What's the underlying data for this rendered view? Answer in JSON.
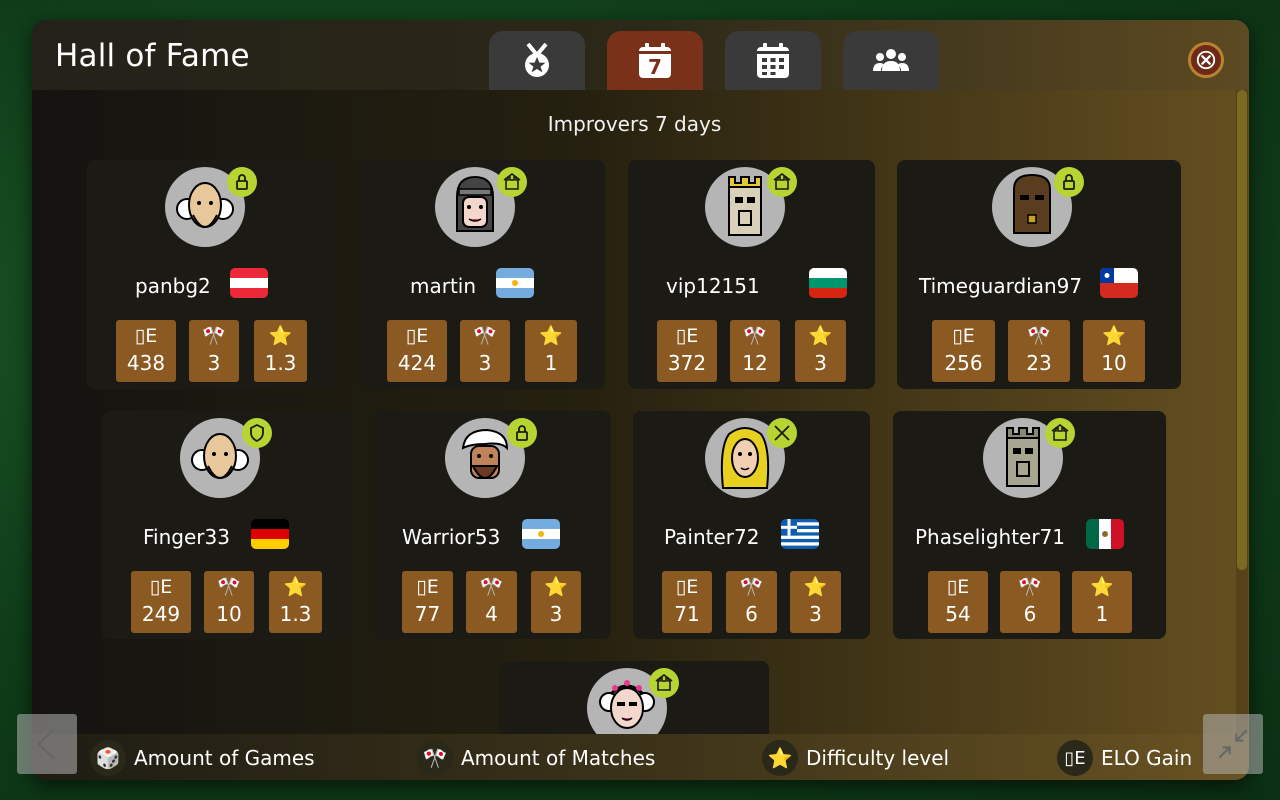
{
  "title": "Hall of Fame",
  "tabs": [
    {
      "name": "medal",
      "active": false
    },
    {
      "name": "calendar-7",
      "active": true,
      "label": "7"
    },
    {
      "name": "calendar",
      "active": false
    },
    {
      "name": "group",
      "active": false
    }
  ],
  "section_title": "Improvers 7 days",
  "players": [
    {
      "name": "panbg2",
      "flag": "Austria",
      "avatar": "old-man",
      "badge": "lock-icon",
      "elo_label": "▯E",
      "elo": "438",
      "matches": "3",
      "difficulty": "1.3"
    },
    {
      "name": "martin",
      "flag": "Argentina",
      "avatar": "knight",
      "badge": "castle-icon",
      "elo_label": "▯E",
      "elo": "424",
      "matches": "3",
      "difficulty": "1"
    },
    {
      "name": "vip12151",
      "flag": "Bulgaria",
      "avatar": "king",
      "badge": "castle-icon",
      "elo_label": "▯E",
      "elo": "372",
      "matches": "12",
      "difficulty": "3"
    },
    {
      "name": "Timeguardian97",
      "flag": "Chile",
      "avatar": "tiki",
      "badge": "lock-icon",
      "elo_label": "▯E",
      "elo": "256",
      "matches": "23",
      "difficulty": "10"
    },
    {
      "name": "Finger33",
      "flag": "Germany",
      "avatar": "old-man",
      "badge": "shield-icon",
      "elo_label": "▯E",
      "elo": "249",
      "matches": "10",
      "difficulty": "1.3"
    },
    {
      "name": "Warrior53",
      "flag": "Argentina",
      "avatar": "turban",
      "badge": "lock-icon",
      "elo_label": "▯E",
      "elo": "77",
      "matches": "4",
      "difficulty": "3"
    },
    {
      "name": "Painter72",
      "flag": "Greece",
      "avatar": "blonde",
      "badge": "swords-icon",
      "elo_label": "▯E",
      "elo": "71",
      "matches": "6",
      "difficulty": "3"
    },
    {
      "name": "Phaselighter71",
      "flag": "Mexico",
      "avatar": "king",
      "badge": "castle-icon",
      "elo_label": "▯E",
      "elo": "54",
      "matches": "6",
      "difficulty": "1"
    },
    {
      "avatar": "flower-girl",
      "badge": "castle-icon"
    }
  ],
  "legend": [
    {
      "icon": "🎲",
      "label": "Amount of Games"
    },
    {
      "icon": "🎌",
      "label": "Amount of Matches"
    },
    {
      "icon": "⭐",
      "label": "Difficulty level"
    },
    {
      "icon": "▯E",
      "label": "ELO Gain"
    }
  ],
  "stat_icons": {
    "matches": "🎌",
    "difficulty": "⭐"
  },
  "colors": {
    "accent": "#7a311a",
    "stat_bg": "#8a5a22",
    "badge": "#b6d432"
  }
}
